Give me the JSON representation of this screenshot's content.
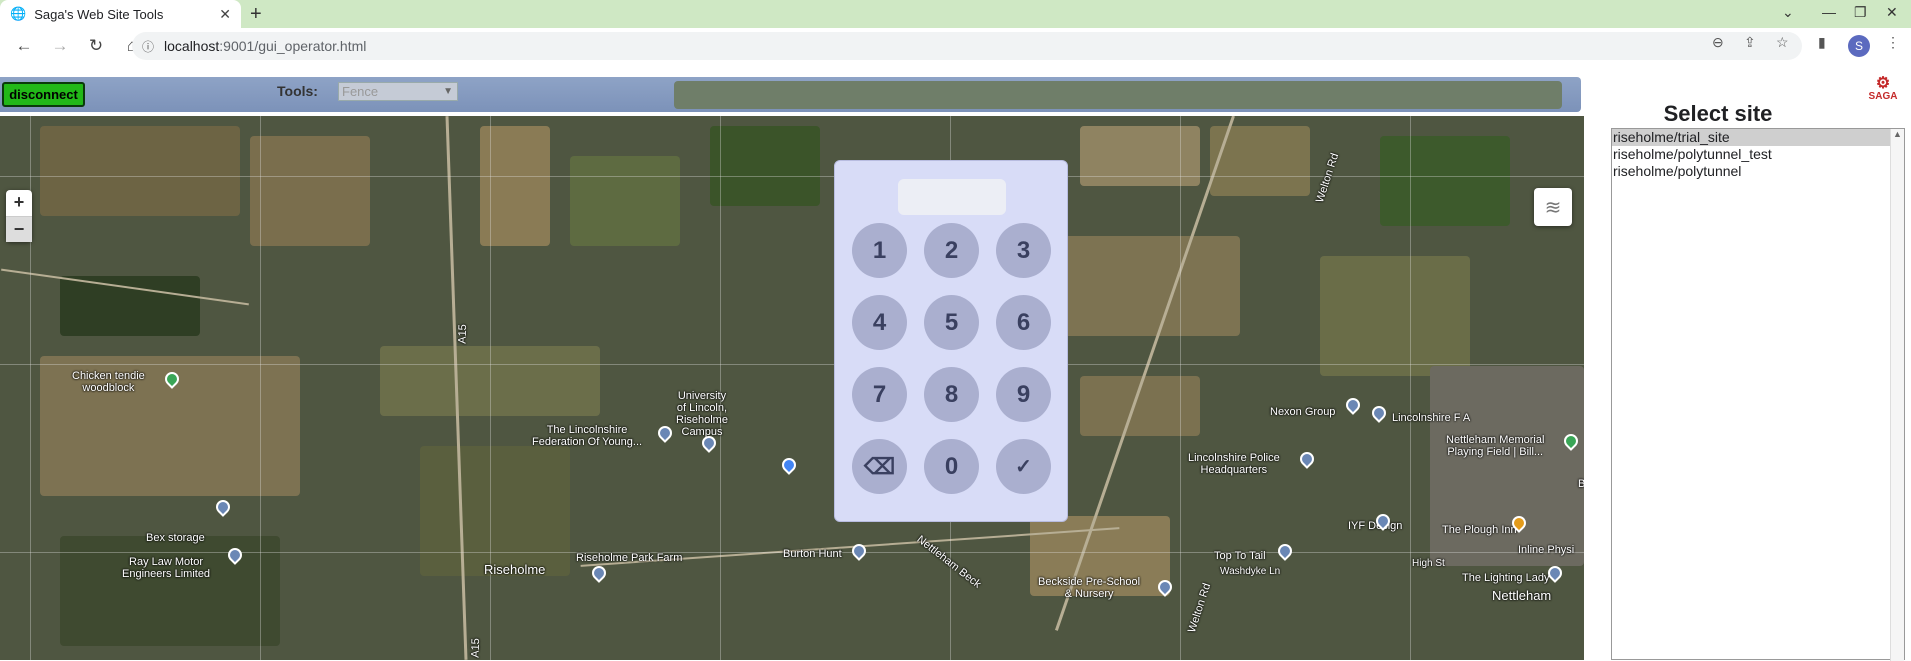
{
  "browser": {
    "tab_title": "Saga's Web Site Tools",
    "new_tab_label": "+",
    "url_host": "localhost",
    "url_path": ":9001/gui_operator.html",
    "profile_initial": "S"
  },
  "app": {
    "disconnect_label": "disconnect",
    "tools_label": "Tools:",
    "tools_selected": "Fence",
    "zoom_in": "+",
    "zoom_out": "−"
  },
  "keypad": {
    "display_value": "",
    "keys": [
      "1",
      "2",
      "3",
      "4",
      "5",
      "6",
      "7",
      "8",
      "9",
      "⌫",
      "0",
      "✓"
    ]
  },
  "map_labels": {
    "a15_top": "A15",
    "a15_bottom": "A15",
    "welton_road_top": "Welton Rd",
    "welton_road_bottom": "Welton Rd",
    "chicken_tendie": "Chicken tendie\nwoodblock",
    "university": "University\nof Lincoln,\nRiseholme\nCampus",
    "lincolnshire_federation": "The Lincolnshire\nFederation Of Young...",
    "bex_storage": "Bex storage",
    "ray_law": "Ray Law Motor\nEngineers Limited",
    "riseholme": "Riseholme",
    "riseholme_park_farm": "Riseholme Park Farm",
    "burton_hunt": "Burton Hunt",
    "nettleham_beck": "Nettleham Beck",
    "beckside": "Beckside Pre-School\n& Nursery",
    "nexon": "Nexon Group",
    "lincolnshire_fa": "Lincolnshire F A",
    "lincolnshire_police": "Lincolnshire Police\nHeadquarters",
    "nettleham_memorial": "Nettleham Memorial\nPlaying Field | Bill...",
    "iyf_design": "IYF Design",
    "plough_inn": "The Plough Inn",
    "inline_physio": "Inline Physi",
    "top_to_tail": "Top To Tail",
    "washdyke_ln": "Washdyke Ln",
    "high_st": "High St",
    "lighting_lady": "The Lighting Lady",
    "nettleham": "Nettleham",
    "b_label": "B"
  },
  "side": {
    "title": "Select site",
    "logo_text": "SAGA",
    "sites": [
      "riseholme/trial_site",
      "riseholme/polytunnel_test",
      "riseholme/polytunnel"
    ],
    "selected_index": 0
  },
  "colors": {
    "disconnect_bg": "#22b818",
    "keypad_bg": "#d8dcf7",
    "key_bg": "#aaafcf"
  }
}
